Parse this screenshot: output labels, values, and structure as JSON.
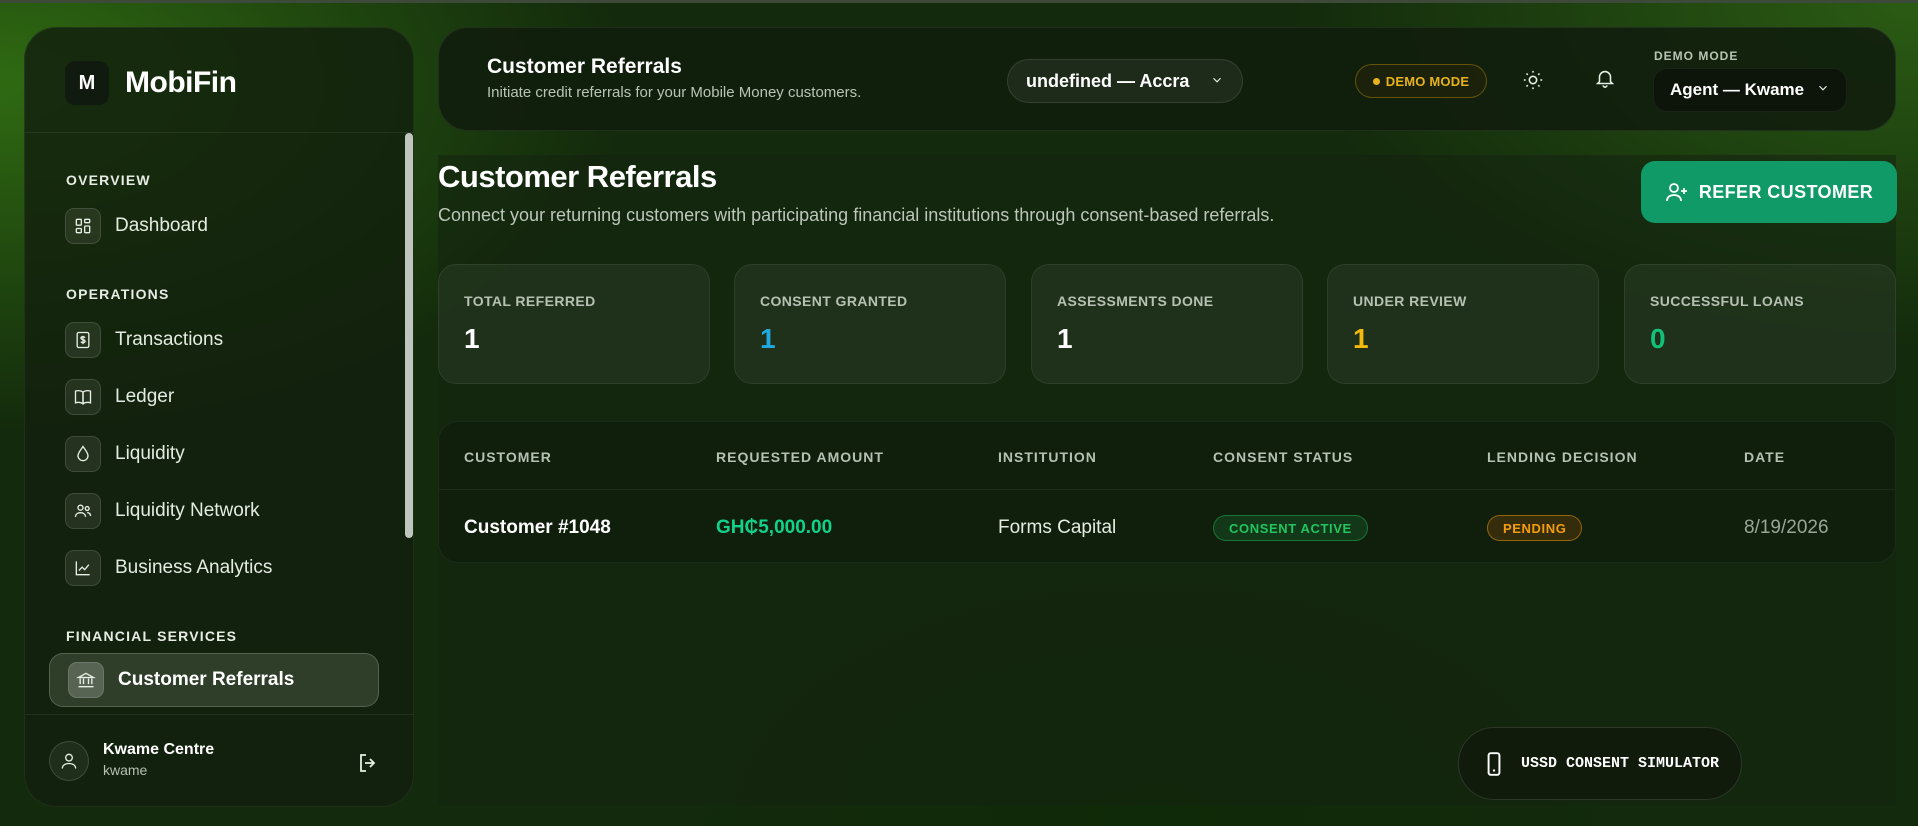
{
  "brand": {
    "logo_letter": "M",
    "name": "MobiFin"
  },
  "sidebar": {
    "sections": [
      {
        "label": "OVERVIEW"
      },
      {
        "label": "OPERATIONS"
      },
      {
        "label": "FINANCIAL SERVICES"
      }
    ],
    "items": [
      {
        "label": "Dashboard",
        "icon": "dashboard-icon"
      },
      {
        "label": "Transactions",
        "icon": "receipt-icon"
      },
      {
        "label": "Ledger",
        "icon": "book-icon"
      },
      {
        "label": "Liquidity",
        "icon": "droplet-icon"
      },
      {
        "label": "Liquidity Network",
        "icon": "users-icon"
      },
      {
        "label": "Business Analytics",
        "icon": "chart-icon"
      },
      {
        "label": "Customer Referrals",
        "icon": "bank-icon",
        "active": true
      }
    ],
    "user": {
      "name": "Kwame Centre",
      "handle": "kwame"
    }
  },
  "header": {
    "title": "Customer Referrals",
    "subtitle": "Initiate credit referrals for your Mobile Money customers.",
    "branch_select": "undefined — Accra",
    "demo_badge": "DEMO MODE",
    "mode_label": "DEMO MODE",
    "mode_select": "Agent — Kwame"
  },
  "main": {
    "title": "Customer Referrals",
    "subtitle": "Connect your returning customers with participating financial institutions through consent-based referrals.",
    "refer_button": "REFER CUSTOMER",
    "stats": [
      {
        "label": "TOTAL REFERRED",
        "value": "1",
        "color": "#ffffff"
      },
      {
        "label": "CONSENT GRANTED",
        "value": "1",
        "color": "#22a8e0"
      },
      {
        "label": "ASSESSMENTS DONE",
        "value": "1",
        "color": "#ffffff"
      },
      {
        "label": "UNDER REVIEW",
        "value": "1",
        "color": "#f5b90b"
      },
      {
        "label": "SUCCESSFUL LOANS",
        "value": "0",
        "color": "#12c07a"
      }
    ],
    "table": {
      "headers": [
        "CUSTOMER",
        "REQUESTED AMOUNT",
        "INSTITUTION",
        "CONSENT STATUS",
        "LENDING DECISION",
        "DATE"
      ],
      "rows": [
        {
          "customer": "Customer #1048",
          "amount": "GH₵5,000.00",
          "institution": "Forms Capital",
          "consent_status": "CONSENT ACTIVE",
          "lending_decision": "PENDING",
          "date": "8/19/2026"
        }
      ]
    }
  },
  "ussd_button": "USSD CONSENT SIMULATOR",
  "colors": {
    "accent": "#0f9a68",
    "amount": "#12d18a",
    "warning": "#e6b31c"
  }
}
